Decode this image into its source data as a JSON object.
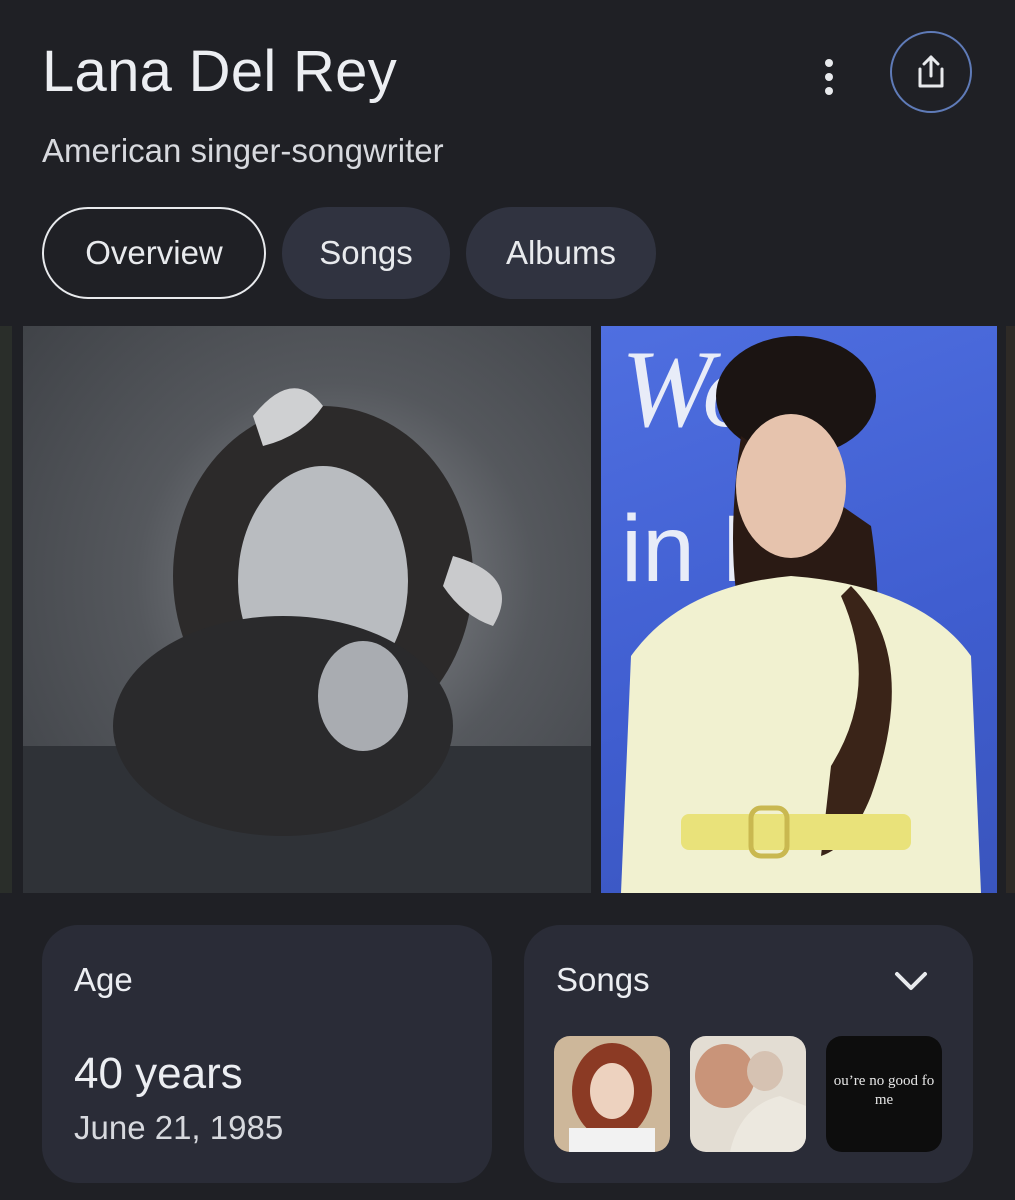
{
  "header": {
    "title": "Lana Del Rey",
    "subtitle": "American singer-songwriter",
    "more_icon": "more-vert-icon",
    "share_icon": "share-icon"
  },
  "tabs": [
    {
      "label": "Overview",
      "active": true
    },
    {
      "label": "Songs",
      "active": false
    },
    {
      "label": "Albums",
      "active": false
    }
  ],
  "images": {
    "photo_bw_text": "",
    "photo_color_sign_text": "Won in M"
  },
  "cards": {
    "age": {
      "label": "Age",
      "value": "40 years",
      "date": "June 21, 1985"
    },
    "songs": {
      "label": "Songs",
      "expand_icon": "chevron-down-icon",
      "thumbnail_caption_line1": "ou’re no good fo",
      "thumbnail_caption_line2": "me"
    }
  },
  "colors": {
    "background": "#1f2025",
    "tab_bg": "#303340",
    "card_bg": "#2a2c37",
    "share_ring": "#5f7bb8",
    "text_primary": "#eceef2"
  }
}
